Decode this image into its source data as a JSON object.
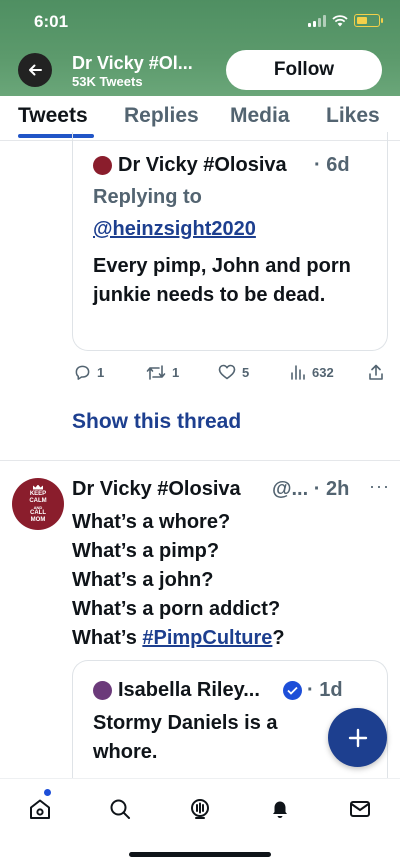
{
  "status_bar": {
    "time": "6:01"
  },
  "header": {
    "profile_name": "Dr Vicky #Ol...",
    "tweet_count": "53K Tweets",
    "follow_label": "Follow",
    "banner_color": "#5c9a6c"
  },
  "tabs": [
    {
      "label": "Tweets",
      "active": true
    },
    {
      "label": "Replies",
      "active": false
    },
    {
      "label": "Media",
      "active": false
    },
    {
      "label": "Likes",
      "active": false
    }
  ],
  "quoted_tweet_1": {
    "author": "Dr Vicky #Olosiva",
    "time": "· 6d",
    "replying_to_label": "Replying to",
    "replying_to_handle": "@heinzsight2020",
    "text": "Every pimp, John and porn junkie needs to be dead."
  },
  "actions": {
    "replies": "1",
    "retweets": "1",
    "likes": "5",
    "views": "632"
  },
  "show_thread_label": "Show this thread",
  "tweet_2": {
    "avatar_text": [
      "KEEP",
      "CALM",
      "AND",
      "CALL",
      "MOM"
    ],
    "author": "Dr Vicky #Olosiva",
    "handle_time": "@... · 2h",
    "more": "···",
    "lines": [
      "What’s a whore?",
      "What’s a pimp?",
      "What’s a john?",
      "What’s a porn addict?"
    ],
    "last_line_prefix": "What’s ",
    "hashtag": "#PimpCulture",
    "last_line_suffix": "?"
  },
  "quoted_tweet_2": {
    "author": "Isabella Riley...",
    "time": "· 1d",
    "text": "Stormy Daniels is a whore."
  },
  "colors": {
    "link": "#1d3f8f",
    "muted": "#536471",
    "fab": "#1d3f8f"
  },
  "bottom_nav": [
    "home-icon",
    "search-icon",
    "spaces-icon",
    "notifications-icon",
    "messages-icon"
  ]
}
